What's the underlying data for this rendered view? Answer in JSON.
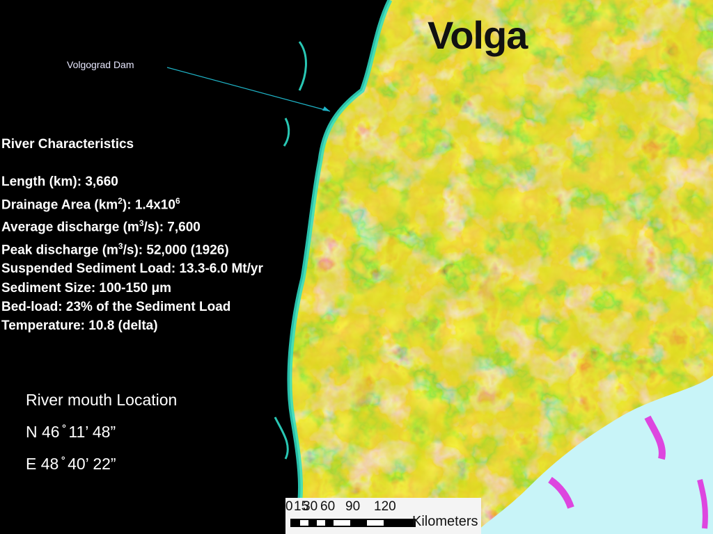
{
  "title": "Volga",
  "dam_label": "Volgograd Dam",
  "river": {
    "heading": "River Characteristics",
    "rows": [
      {
        "label": "Length (km):",
        "value": "3,660"
      },
      {
        "label": "Drainage Area (km",
        "sup": "2",
        "label_end": "):",
        "value": "1.4x10",
        "value_sup": "6"
      },
      {
        "label": "Average discharge (m",
        "sup": "3",
        "label_end": "/s):",
        "value": "7,600"
      },
      {
        "label": "Peak discharge (m",
        "sup": "3",
        "label_end": "/s):",
        "value": "52,000 (1926)"
      },
      {
        "label": "Suspended Sediment Load:",
        "value": "13.3-6.0 Mt/yr"
      },
      {
        "label": "Sediment Size:",
        "value": "100-150 μm"
      },
      {
        "label": "Bed-load:",
        "value": "23% of the Sediment Load"
      },
      {
        "label": "Temperature:",
        "value": "10.8 (delta)"
      }
    ]
  },
  "mouth": {
    "heading": "River mouth Location",
    "lat": "N 46 ̊ 11’ 48”",
    "lon": "E 48 ̊ 40’ 22”"
  },
  "scale": {
    "ticks": [
      "0",
      "15",
      "30",
      "60",
      "90",
      "120"
    ],
    "units": "Kilometers"
  },
  "colors": {
    "background": "#000000",
    "sea": "#c8f4f8",
    "callout_line": "#1fb5c8"
  }
}
